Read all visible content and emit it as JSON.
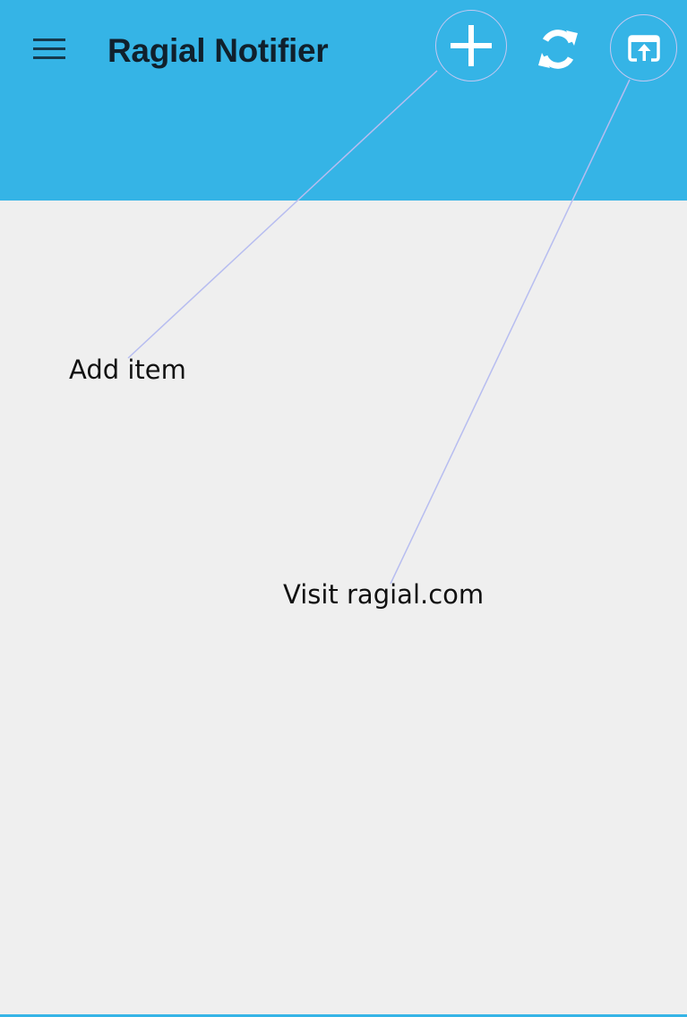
{
  "app": {
    "title": "Ragial Notifier",
    "accent_color": "#35b4e6",
    "background_color": "#efefef"
  },
  "toolbar": {
    "menu_icon": "hamburger-menu-icon",
    "actions": [
      {
        "id": "add",
        "icon": "plus-icon"
      },
      {
        "id": "refresh",
        "icon": "refresh-icon"
      },
      {
        "id": "open",
        "icon": "open-in-browser-icon"
      }
    ]
  },
  "annotations": {
    "add_item": "Add item",
    "visit_site": "Visit ragial.com"
  }
}
